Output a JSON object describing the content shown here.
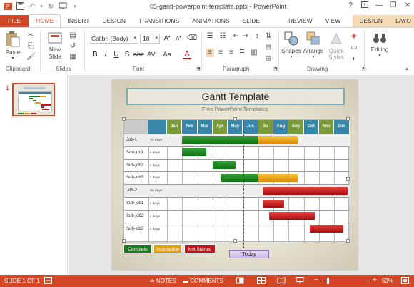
{
  "titlebar": {
    "doc_title": "05-gantt-powerpoint-template.pptx - PowerPoint",
    "window_controls": [
      "?",
      "—",
      "❐",
      "✕"
    ]
  },
  "tabs": [
    {
      "label": "FILE"
    },
    {
      "label": "HOME"
    },
    {
      "label": "INSERT"
    },
    {
      "label": "DESIGN"
    },
    {
      "label": "TRANSITIONS"
    },
    {
      "label": "ANIMATIONS"
    },
    {
      "label": "SLIDE SHOW"
    },
    {
      "label": "REVIEW"
    },
    {
      "label": "VIEW"
    },
    {
      "label": "DESIGN"
    },
    {
      "label": "LAYO"
    }
  ],
  "ribbon": {
    "paste_label": "Paste",
    "new_slide_label": "New Slide",
    "font_name": "Calibri (Body)",
    "font_size": "18",
    "shapes_label": "Shapes",
    "arrange_label": "Arrange",
    "quick_styles_label": "Quick Styles",
    "editing_label": "Editing",
    "groups": {
      "clipboard": "Clipboard",
      "slides": "Slides",
      "font": "Font",
      "paragraph": "Paragraph",
      "drawing": "Drawing"
    }
  },
  "thumbnails": [
    {
      "number": "1"
    }
  ],
  "slide": {
    "title": "Gantt Template",
    "subtitle": "Free PowerPoint Templates",
    "months": [
      "Jan",
      "Feb",
      "Mar",
      "Apr",
      "May",
      "Jun",
      "Jul",
      "Aug",
      "Sep",
      "Oct",
      "Nov",
      "Dec"
    ],
    "month_colors": [
      "#7b9a3c",
      "#3a86a8",
      "#3a86a8",
      "#7b9a3c",
      "#3a86a8",
      "#3a86a8",
      "#7b9a3c",
      "#3a86a8",
      "#7b9a3c",
      "#3a86a8",
      "#7b9a3c",
      "#3a86a8"
    ],
    "rows": [
      {
        "name": "Job-1",
        "days": "Xx days"
      },
      {
        "name": "Sub-job1",
        "days": "x days"
      },
      {
        "name": "Sub-job2",
        "days": "x days"
      },
      {
        "name": "Sub-job3",
        "days": "x days"
      },
      {
        "name": "Job-2",
        "days": "Xx days"
      },
      {
        "name": "Sub-job1",
        "days": "x days"
      },
      {
        "name": "Sub-job2",
        "days": "x days"
      },
      {
        "name": "Sub-job3",
        "days": "x days"
      }
    ],
    "legend": [
      {
        "label": "Complete",
        "color": "#1a7a1e"
      },
      {
        "label": "Incomplete",
        "color": "#e0a010"
      },
      {
        "label": "Not Started",
        "color": "#c0141a"
      }
    ],
    "today_label": "Today"
  },
  "statusbar": {
    "slide_info": "SLIDE 1 OF 1",
    "notes_label": "NOTES",
    "comments_label": "COMMENTS",
    "zoom_minus": "−",
    "zoom_plus": "+",
    "zoom": "52%"
  },
  "colors": {
    "accent": "#d24726",
    "complete": "#1a7a1e",
    "incomplete": "#e0a010",
    "not_started": "#c0141a"
  }
}
